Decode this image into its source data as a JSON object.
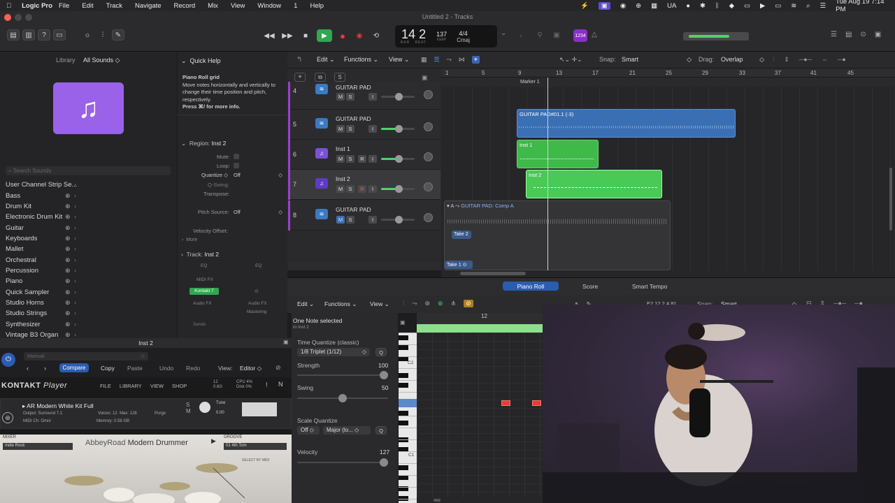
{
  "menubar": {
    "app": "Logic Pro",
    "items": [
      "File",
      "Edit",
      "Track",
      "Navigate",
      "Record",
      "Mix",
      "View",
      "Window",
      "1",
      "Help"
    ],
    "locale": "UA",
    "datetime": "Tue Aug 19  7:14 PM"
  },
  "window_title": "Untitled 2 - Tracks",
  "transport": {
    "bar": "14",
    "beat": "2",
    "bar_lbl": "BAR",
    "beat_lbl": "BEAT",
    "tempo": "137",
    "keep": "KEEP",
    "sig": "4/4",
    "key": "Cmaj",
    "lcd_mode": "1234"
  },
  "library": {
    "title": "Library",
    "sounds": "All Sounds",
    "search_placeholder": "Search Sounds",
    "items": [
      "User Channel Strip Se...",
      "Bass",
      "Drum Kit",
      "Electronic Drum Kit",
      "Guitar",
      "Keyboards",
      "Mallet",
      "Orchestral",
      "Percussion",
      "Piano",
      "Quick Sampler",
      "Studio Horns",
      "Studio Strings",
      "Synthesizer",
      "Vintage B3 Organ"
    ]
  },
  "quickhelp": {
    "title": "Quick Help",
    "heading": "Piano Roll grid",
    "body": "Move notes horizontally and vertically to change their time position and pitch, respectively.",
    "bold": "Press ⌘/ for more info."
  },
  "inspector": {
    "region_label": "Region:",
    "region_name": "Inst 2",
    "mute": "Mute:",
    "loop": "Loop:",
    "quantize": "Quantize ◇",
    "quantize_val": "Off",
    "qswing": "Q-Swing:",
    "transpose": "Transpose:",
    "pitch_source": "Pitch Source:",
    "pitch_source_val": "Off",
    "velocity_offset": "Velocity Offset:",
    "more": "More",
    "track_label": "Track:",
    "track_name": "Inst 2",
    "eq": "EQ",
    "eq2": "EQ",
    "midi_fx": "MIDI FX",
    "plugin": "Kontakt 7",
    "audio_fx": "Audio FX",
    "audio_fx2": "Audio FX",
    "mastering": "Mastering",
    "sends": "Sends"
  },
  "tracks_toolbar": {
    "edit": "Edit",
    "functions": "Functions",
    "view": "View",
    "snap_lbl": "Snap:",
    "snap": "Smart",
    "drag_lbl": "Drag:",
    "drag": "Overlap"
  },
  "ruler": [
    "1",
    "5",
    "9",
    "13",
    "17",
    "21",
    "25",
    "29",
    "33",
    "37",
    "41",
    "45"
  ],
  "marker": "Marker 1",
  "tracks": [
    {
      "num": "4",
      "name": "GUITAR PAD",
      "type": "audio"
    },
    {
      "num": "5",
      "name": "GUITAR PAD",
      "type": "audio"
    },
    {
      "num": "6",
      "name": "Inst 1",
      "type": "inst"
    },
    {
      "num": "7",
      "name": "Inst 2",
      "type": "inst"
    },
    {
      "num": "8",
      "name": "GUITAR PAD",
      "type": "audio"
    }
  ],
  "msr": {
    "m": "M",
    "s": "S",
    "r": "R",
    "i": "I"
  },
  "regions": {
    "r5": "GUITAR PAD#01.1 (-3)",
    "r6": "Inst 1",
    "r7": "Inst 2",
    "r8": "GUITAR PAD: Comp A",
    "take2": "Take 2",
    "take1": "Take 1"
  },
  "plugin_window": {
    "title": "Inst 2",
    "preset": "Manual",
    "compare": "Compare",
    "copy": "Copy",
    "paste": "Paste",
    "undo": "Undo",
    "redo": "Redo",
    "view_lbl": "View:",
    "view": "Editor"
  },
  "kontakt": {
    "brand": "KONTAKT",
    "player": "Player",
    "menu": [
      "FILE",
      "LIBRARY",
      "VIEW",
      "SHOP"
    ],
    "voices": "12",
    "mem": "0.6G",
    "cpu": "CPU 4%",
    "disk": "Disk 0%",
    "instrument": "AR Modern White Kit Full",
    "output": "Output: Surround 7.1",
    "voices_lbl": "Voices:",
    "voices_val": "12",
    "max_lbl": "Max:",
    "max_val": "128",
    "purge": "Purge",
    "midi": "MIDI Ch: Omni",
    "memory": "Memory: 0.58 GB",
    "tune": "Tune",
    "tune_val": "0.00",
    "mixer": "MIXER",
    "mixer_preset": "Indie Rock",
    "abbey": "AbbeyRoad",
    "modern": "Modern Drummer",
    "groove": "GROOVE",
    "groove_val": "01 4th Tom",
    "select_midi": "SELECT BY MIDI"
  },
  "editor_tabs": [
    "Piano Roll",
    "Score",
    "Smart Tempo"
  ],
  "piano_roll": {
    "edit": "Edit",
    "functions": "Functions",
    "view": "View",
    "selected": "One Note selected",
    "in_region": "in Inst 2",
    "tq": "Time Quantize (classic)",
    "tq_val": "1/8 Triplet (1/12)",
    "q": "Q",
    "strength": "Strength",
    "strength_val": "100",
    "swing": "Swing",
    "swing_val": "50",
    "sq": "Scale Quantize",
    "sq_off": "Off",
    "sq_val": "Major (lo...",
    "velocity": "Velocity",
    "velocity_val": "127",
    "bar": "12",
    "pos": "E2  12 2 4 81",
    "snap_lbl": "Snap:",
    "snap": "Smart",
    "c2": "C2",
    "c1": "C1"
  }
}
